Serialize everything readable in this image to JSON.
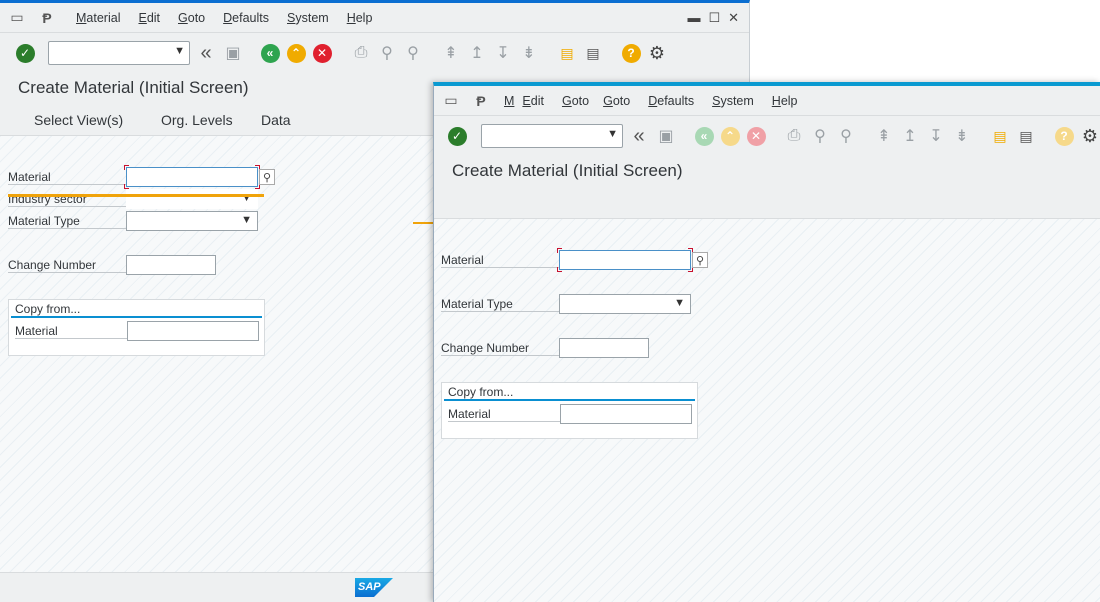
{
  "left_window": {
    "menu": [
      "Material",
      "Edit",
      "Goto",
      "Defaults",
      "System",
      "Help"
    ],
    "title": "Create Material (Initial Screen)",
    "app_toolbar": [
      "Select View(s)",
      "Org. Levels",
      "Data"
    ],
    "fields": {
      "material": "Material",
      "industry_sector": "Industry sector",
      "material_type": "Material Type",
      "change_number": "Change Number"
    },
    "copy_group": {
      "title": "Copy from...",
      "material": "Material"
    },
    "footer_logo": "SAP"
  },
  "right_window": {
    "menu": [
      "M",
      "Edit",
      "Goto",
      "Goto",
      "Defaults",
      "System",
      "Help"
    ],
    "title": "Create Material (Initial Screen)",
    "fields": {
      "material": "Material",
      "material_type": "Material Type",
      "change_number": "Change Number"
    },
    "copy_group": {
      "title": "Copy from...",
      "material": "Material"
    }
  },
  "colors": {
    "enter_green": "#2b7d2b",
    "back_green": "#2ea44f",
    "exit_orange": "#f0ab00",
    "cancel_red": "#e0202e",
    "help_orange": "#f0ab00",
    "annotation": "#f0a30a",
    "accent_blue": "#0a8fd1"
  }
}
